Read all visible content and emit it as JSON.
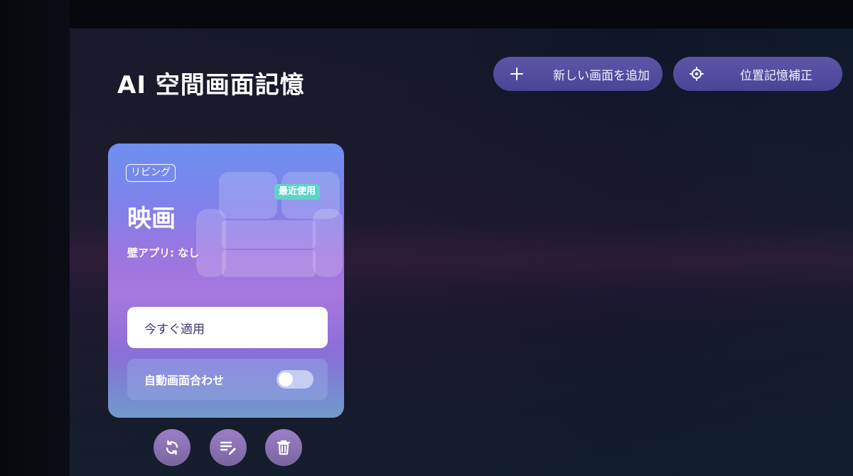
{
  "header": {
    "title": "AI 空間画面記憶",
    "add_button_label": "新しい画面を追加",
    "calibrate_button_label": "位置記憶補正"
  },
  "card": {
    "room_tag": "リビング",
    "recent_badge": "最近使用",
    "title": "映画",
    "subtitle": "壁アプリ: なし",
    "apply_label": "今すぐ適用",
    "auto_match_label": "自動画面合わせ",
    "auto_match_enabled": false,
    "background_icon": "sofa-icon"
  },
  "card_actions": {
    "icons": [
      "refresh-icon",
      "edit-list-icon",
      "trash-icon"
    ]
  },
  "colors": {
    "button_purple": "#5d55a8",
    "badge_teal": "#5fd3c8",
    "card_top": "#6d90ee",
    "card_mid": "#a678dc",
    "action_button": "#8c72b4"
  }
}
